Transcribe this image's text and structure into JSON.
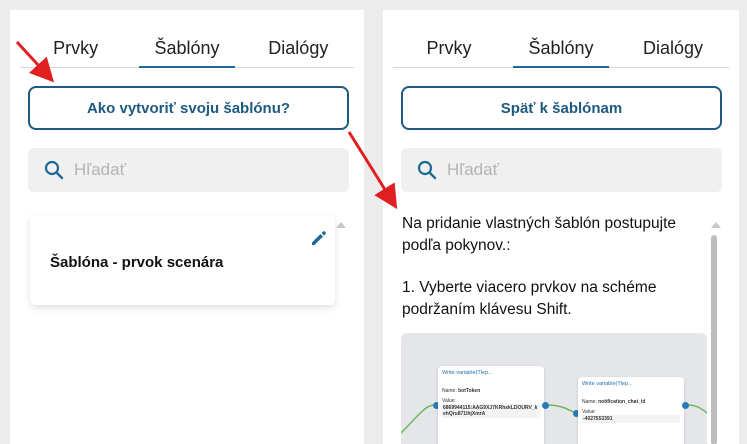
{
  "tabs": [
    "Prvky",
    "Šablóny",
    "Dialógy"
  ],
  "left_panel": {
    "active_tab": "Šablóny",
    "how_to_button": "Ako vytvoriť svoju šablónu?",
    "search_placeholder": "Hľadať",
    "template_card": {
      "title": "Šablóna - prvok scenára"
    }
  },
  "right_panel": {
    "active_tab": "Šablóny",
    "back_button": "Späť k šablónam",
    "search_placeholder": "Hľadať",
    "instructions": [
      "Na pridanie vlastných šablón postupujte podľa pokynov.:",
      "1. Vyberte viacero prvkov na schéme podržaním klávesu Shift."
    ],
    "preview": {
      "node1": {
        "title": "Write variable(Tlep...",
        "name_label": "Name:",
        "name_value": "botToken",
        "value_label": "Value:",
        "value_text": "6869944115:AAG9XJ7KRhskLDOURV_kehQru871lhjXmrA"
      },
      "node2": {
        "title": "Write variable(Tlep...",
        "name_label": "Name:",
        "name_value": "notification_chat_id",
        "value_label": "Value:",
        "value_text": "-4027553391"
      }
    }
  },
  "colors": {
    "accent": "#1e5a80",
    "arrow": "#e02020"
  }
}
